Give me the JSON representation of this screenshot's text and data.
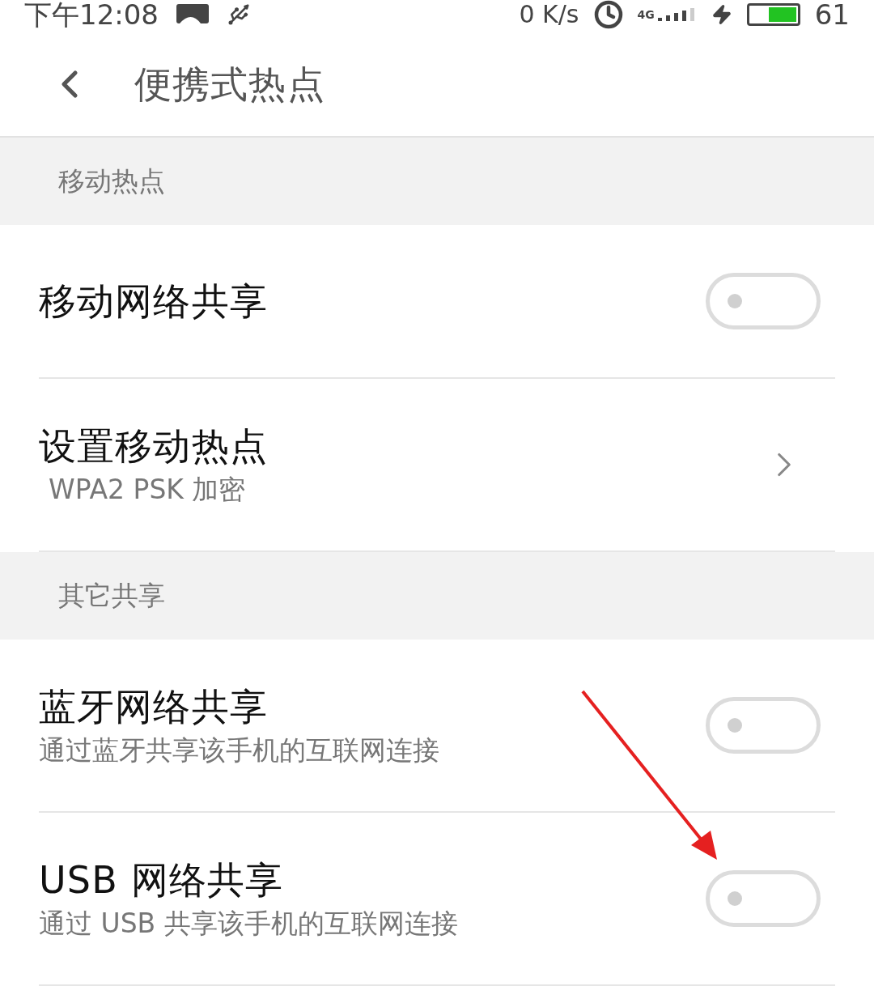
{
  "status_bar": {
    "time": "下午12:08",
    "speed": "0 K/s",
    "network": "4G",
    "level": 0.61,
    "battery": "61"
  },
  "header": {
    "title": "便携式热点"
  },
  "sections": [
    {
      "title": "移动热点",
      "items": [
        {
          "kind": "switch",
          "label": "移动网络共享",
          "on": false
        },
        {
          "kind": "link",
          "label": "设置移动热点",
          "subtitle": "WPA2 PSK 加密"
        }
      ]
    },
    {
      "title": "其它共享",
      "items": [
        {
          "kind": "switch",
          "label": "蓝牙网络共享",
          "subtitle": "通过蓝牙共享该手机的互联网连接",
          "on": false
        },
        {
          "kind": "switch",
          "label": "USB 网络共享",
          "subtitle": "通过 USB 共享该手机的互联网连接",
          "on": false
        }
      ]
    }
  ]
}
